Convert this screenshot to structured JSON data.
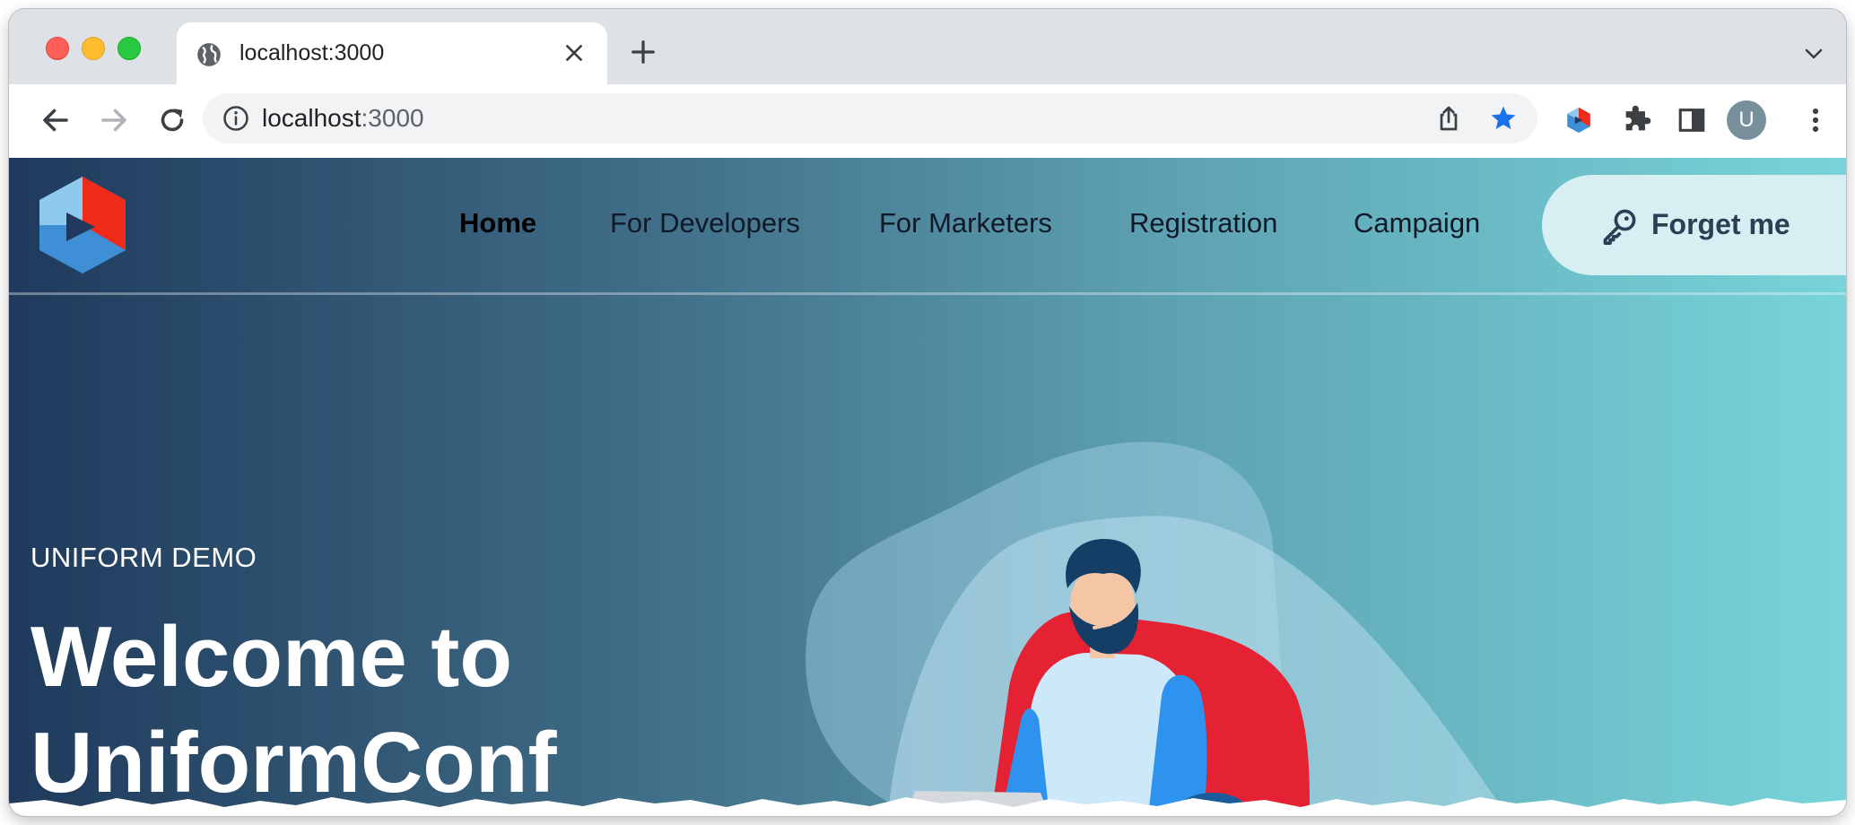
{
  "browser": {
    "tab": {
      "title": "localhost:3000",
      "icon": "globe-icon"
    },
    "address_bar": {
      "host": "localhost",
      "port": ":3000",
      "icon": "info-icon"
    },
    "profile_initial": "U",
    "icons": [
      "back-arrow-icon",
      "forward-arrow-icon",
      "reload-icon",
      "share-icon",
      "star-icon",
      "uniform-extension-icon",
      "puzzle-extension-icon",
      "side-panel-icon",
      "kebab-menu-icon",
      "close-icon",
      "plus-icon",
      "chevron-down-icon"
    ]
  },
  "site": {
    "nav": {
      "items": [
        {
          "label": "Home",
          "active": true
        },
        {
          "label": "For Developers",
          "active": false
        },
        {
          "label": "For Marketers",
          "active": false
        },
        {
          "label": "Registration",
          "active": false
        },
        {
          "label": "Campaign",
          "active": false
        }
      ],
      "cta": {
        "label": "Forget me",
        "icon": "key-icon"
      }
    },
    "hero": {
      "eyebrow": "UNIFORM DEMO",
      "title_lines": [
        "Welcome to",
        "UniformConf"
      ]
    },
    "colors": {
      "gradient_start": "#1f3a5c",
      "gradient_end": "#78d4d9",
      "cta_background": "#d7eff2",
      "logo_red": "#ef2b1a",
      "logo_blue": "#3f8fd6",
      "chair_red": "#e52233",
      "shirt_blue": "#2e93ee"
    }
  }
}
